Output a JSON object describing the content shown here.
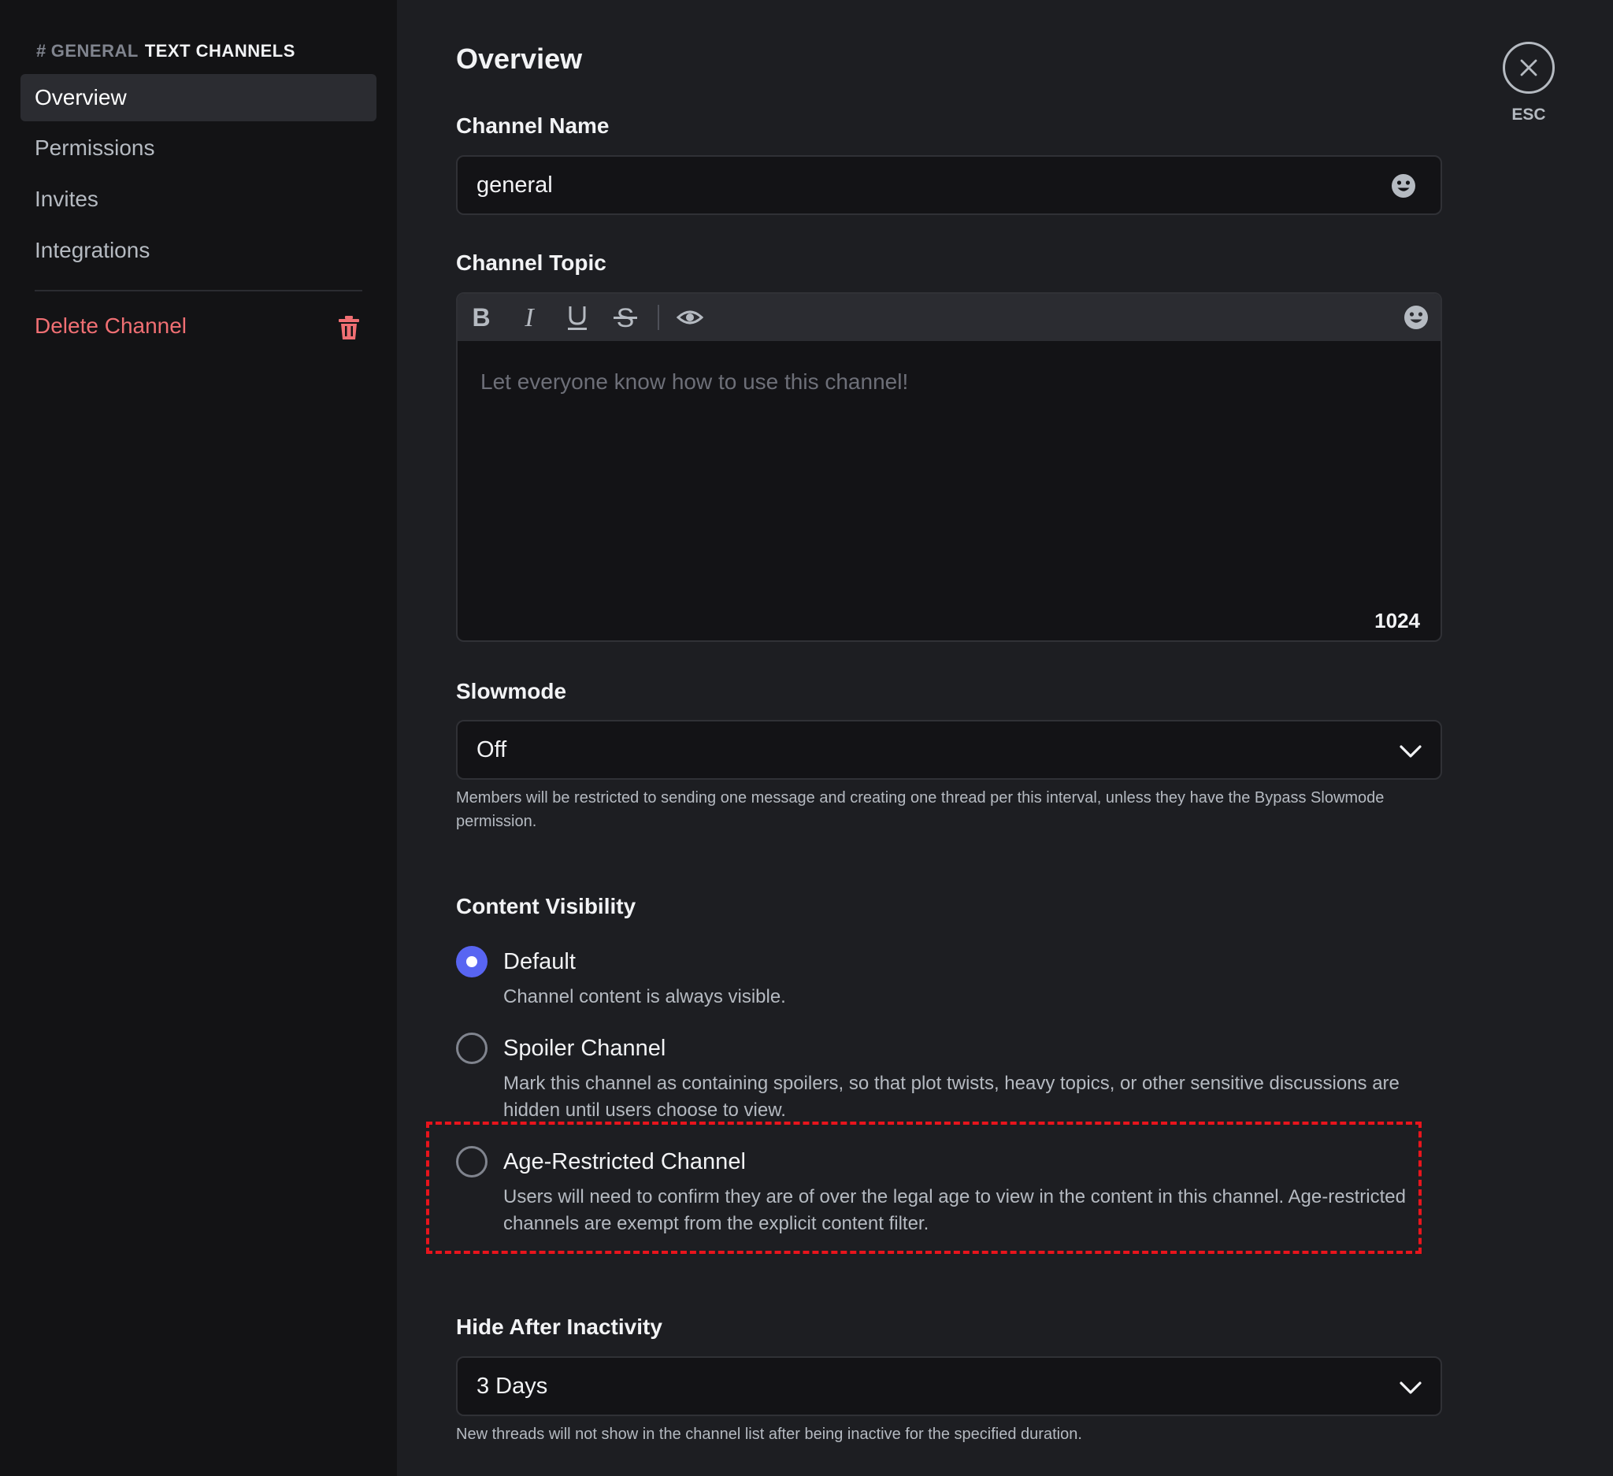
{
  "sidebar": {
    "channel_hash": "#",
    "channel_name": "GENERAL",
    "category": "TEXT CHANNELS",
    "items": [
      {
        "label": "Overview",
        "active": true
      },
      {
        "label": "Permissions",
        "active": false
      },
      {
        "label": "Invites",
        "active": false
      },
      {
        "label": "Integrations",
        "active": false
      }
    ],
    "delete_label": "Delete Channel",
    "delete_icon": "trash-icon"
  },
  "header": {
    "title": "Overview",
    "close_icon": "close-icon",
    "esc_label": "ESC"
  },
  "channel_name": {
    "label": "Channel Name",
    "value": "general",
    "icon": "emoji-icon"
  },
  "channel_topic": {
    "label": "Channel Topic",
    "toolbar": [
      "bold-icon",
      "italic-icon",
      "underline-icon",
      "strikethrough-icon",
      "spoiler-eye-icon",
      "emoji-icon"
    ],
    "placeholder": "Let everyone know how to use this channel!",
    "char_remaining": "1024"
  },
  "slowmode": {
    "label": "Slowmode",
    "selected": "Off",
    "help": "Members will be restricted to sending one message and creating one thread per this interval, unless they have the Bypass Slowmode permission."
  },
  "content_visibility": {
    "label": "Content Visibility",
    "options": [
      {
        "title": "Default",
        "description": "Channel content is always visible.",
        "selected": true
      },
      {
        "title": "Spoiler Channel",
        "description": "Mark this channel as containing spoilers, so that plot twists, heavy topics, or other sensitive discussions are hidden until users choose to view.",
        "selected": false
      },
      {
        "title": "Age-Restricted Channel",
        "description": "Users will need to confirm they are of over the legal age to view in the content in this channel. Age-restricted channels are exempt from the explicit content filter.",
        "selected": false
      }
    ]
  },
  "hide_after_inactivity": {
    "label": "Hide After Inactivity",
    "selected": "3 Days",
    "help": "New threads will not show in the channel list after being inactive for the specified duration."
  },
  "colors": {
    "sidebar_bg": "#131315",
    "main_bg": "#1d1e22",
    "input_bg": "#131316",
    "accent": "#5865f2",
    "danger": "#f06f73",
    "highlight": "#e8141c"
  }
}
